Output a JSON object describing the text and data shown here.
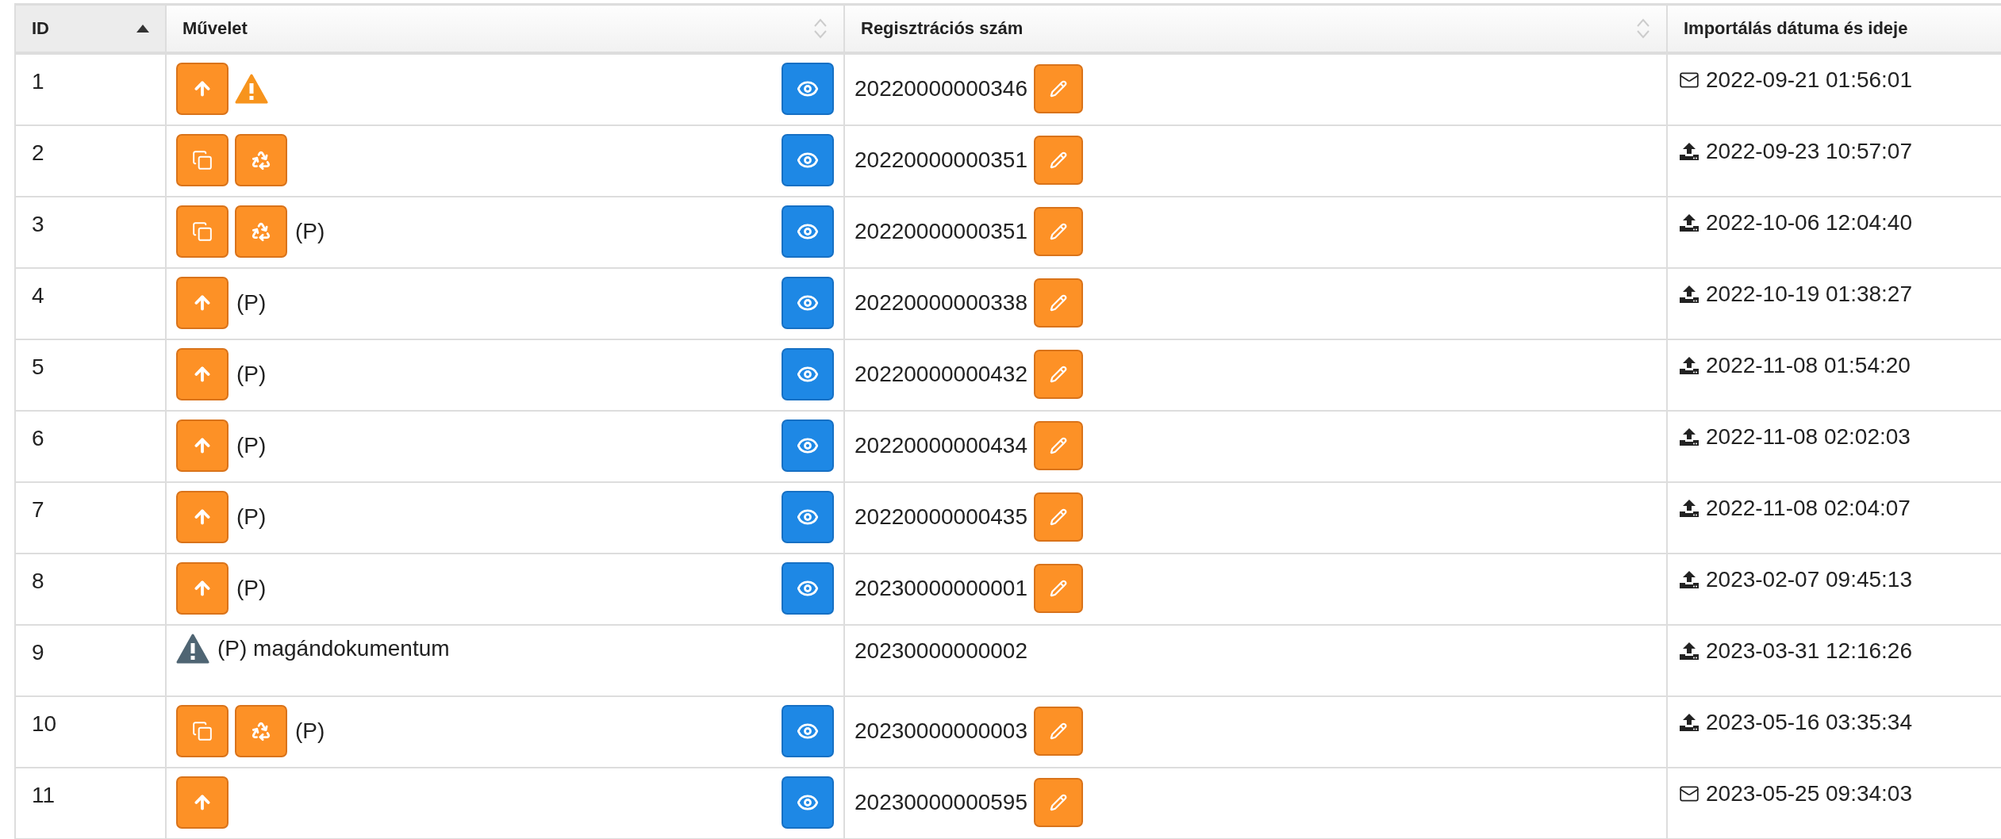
{
  "table": {
    "columns": [
      {
        "label": "ID",
        "sortable": true,
        "sorted": true
      },
      {
        "label": "Művelet",
        "sortable": true,
        "sorted": false
      },
      {
        "label": "Regisztrációs szám",
        "sortable": true,
        "sorted": false
      },
      {
        "label": "Importálás dátuma és ideje",
        "sortable": false,
        "sorted": false
      }
    ],
    "rows": [
      {
        "id": "1",
        "actions": [
          {
            "kind": "upload"
          }
        ],
        "warning": {
          "color": "#f7941d"
        },
        "view": true,
        "reg": "20220000000346",
        "edit": true,
        "source": {
          "kind": "mail"
        },
        "imported": "2022-09-21 01:56:01"
      },
      {
        "id": "2",
        "actions": [
          {
            "kind": "copy"
          },
          {
            "kind": "recycle"
          }
        ],
        "view": true,
        "reg": "20220000000351",
        "edit": true,
        "source": {
          "kind": "upload"
        },
        "imported": "2022-09-23 10:57:07"
      },
      {
        "id": "3",
        "actions": [
          {
            "kind": "copy"
          },
          {
            "kind": "recycle"
          }
        ],
        "note": "(P)",
        "view": true,
        "reg": "20220000000351",
        "edit": true,
        "source": {
          "kind": "upload"
        },
        "imported": "2022-10-06 12:04:40"
      },
      {
        "id": "4",
        "actions": [
          {
            "kind": "upload"
          }
        ],
        "note": "(P)",
        "view": true,
        "reg": "20220000000338",
        "edit": true,
        "source": {
          "kind": "upload"
        },
        "imported": "2022-10-19 01:38:27"
      },
      {
        "id": "5",
        "actions": [
          {
            "kind": "upload"
          }
        ],
        "note": "(P)",
        "view": true,
        "reg": "20220000000432",
        "edit": true,
        "source": {
          "kind": "upload"
        },
        "imported": "2022-11-08 01:54:20"
      },
      {
        "id": "6",
        "actions": [
          {
            "kind": "upload"
          }
        ],
        "note": "(P)",
        "view": true,
        "reg": "20220000000434",
        "edit": true,
        "source": {
          "kind": "upload"
        },
        "imported": "2022-11-08 02:02:03"
      },
      {
        "id": "7",
        "actions": [
          {
            "kind": "upload"
          }
        ],
        "note": "(P)",
        "view": true,
        "reg": "20220000000435",
        "edit": true,
        "source": {
          "kind": "upload"
        },
        "imported": "2022-11-08 02:04:07"
      },
      {
        "id": "8",
        "actions": [
          {
            "kind": "upload"
          }
        ],
        "note": "(P)",
        "view": true,
        "reg": "20230000000001",
        "edit": true,
        "source": {
          "kind": "upload"
        },
        "imported": "2023-02-07 09:45:13"
      },
      {
        "id": "9",
        "actions": [],
        "warning": {
          "color": "#4f6573"
        },
        "note": "(P) magándokumentum",
        "view": false,
        "reg": "20230000000002",
        "edit": false,
        "source": {
          "kind": "upload"
        },
        "imported": "2023-03-31 12:16:26"
      },
      {
        "id": "10",
        "actions": [
          {
            "kind": "copy"
          },
          {
            "kind": "recycle"
          }
        ],
        "note": "(P)",
        "view": true,
        "reg": "20230000000003",
        "edit": true,
        "source": {
          "kind": "upload"
        },
        "imported": "2023-05-16 03:35:34"
      },
      {
        "id": "11",
        "actions": [
          {
            "kind": "upload"
          }
        ],
        "view": true,
        "reg": "20230000000595",
        "edit": true,
        "source": {
          "kind": "mail"
        },
        "imported": "2023-05-25 09:34:03"
      }
    ]
  }
}
